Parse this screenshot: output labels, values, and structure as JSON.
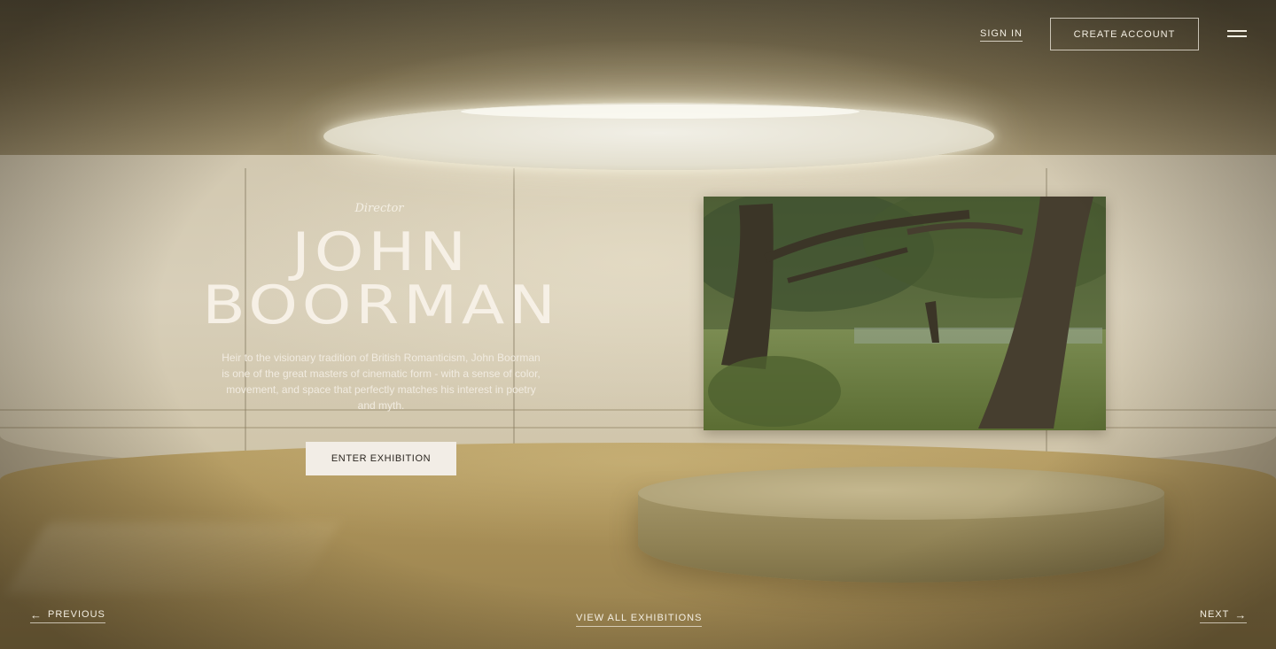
{
  "header": {
    "sign_in": "SIGN IN",
    "create_account": "CREATE ACCOUNT",
    "menu_icon": "hamburger-menu-icon"
  },
  "hero": {
    "role": "Director",
    "name_line1": "JOHN",
    "name_line2": "BOORMAN",
    "description": "Heir to the visionary tradition of British Romanticism, John Boorman is one of the great masters of cinematic form - with a sense of color, movement, and space that perfectly matches his interest in poetry and myth.",
    "enter_button": "ENTER EXHIBITION"
  },
  "footer_nav": {
    "previous": "PREVIOUS",
    "previous_icon": "arrow-left-icon",
    "view_all": "VIEW ALL EXHIBITIONS",
    "next": "NEXT",
    "next_icon": "arrow-right-icon"
  },
  "colors": {
    "text_light": "#f3eee2",
    "button_bg": "#f2ede6",
    "button_text": "#2b2620"
  }
}
